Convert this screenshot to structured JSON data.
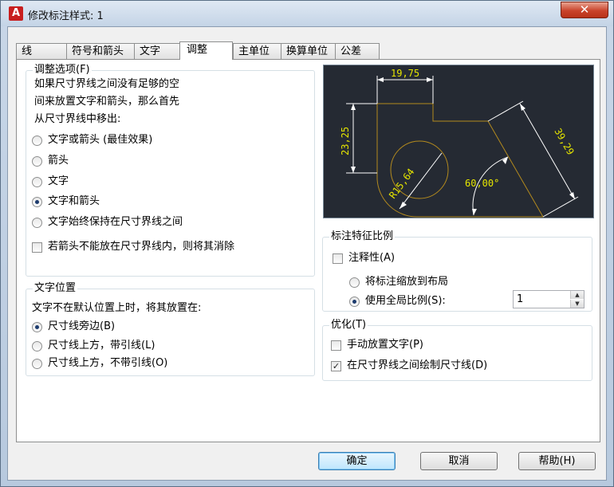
{
  "window": {
    "title": "修改标注样式: 1",
    "close_glyph": "✕",
    "app_icon_letter": "A"
  },
  "tabs": [
    {
      "label": "线"
    },
    {
      "label": "符号和箭头"
    },
    {
      "label": "文字"
    },
    {
      "label": "调整",
      "active": true
    },
    {
      "label": "主单位"
    },
    {
      "label": "换算单位"
    },
    {
      "label": "公差"
    }
  ],
  "fit_options": {
    "title": "调整选项(F)",
    "description": [
      "如果尺寸界线之间没有足够的空",
      "间来放置文字和箭头，那么首先",
      "从尺寸界线中移出:"
    ],
    "radios": [
      {
        "label": "文字或箭头 (最佳效果)",
        "selected": false
      },
      {
        "label": "箭头",
        "selected": false
      },
      {
        "label": "文字",
        "selected": false
      },
      {
        "label": "文字和箭头",
        "selected": true
      },
      {
        "label": "文字始终保持在尺寸界线之间",
        "selected": false
      }
    ],
    "suppress_checkbox": {
      "label": "若箭头不能放在尺寸界线内，则将其消除",
      "checked": false
    }
  },
  "text_placement": {
    "title": "文字位置",
    "description": "文字不在默认位置上时，将其放置在:",
    "radios": [
      {
        "label": "尺寸线旁边(B)",
        "selected": true
      },
      {
        "label": "尺寸线上方，带引线(L)",
        "selected": false
      },
      {
        "label": "尺寸线上方，不带引线(O)",
        "selected": false
      }
    ]
  },
  "preview": {
    "dim_top": "19,75",
    "dim_left": "23,25",
    "dim_right": "39,29",
    "dim_radius": "R15,64",
    "dim_angle": "60,00°",
    "background_color": "#252a33",
    "geometry_color": "#b38a1e",
    "dimension_color": "#ffffff",
    "text_color": "#e6e600"
  },
  "scale_for_features": {
    "title": "标注特征比例",
    "annotative": {
      "label": "注释性(A)",
      "checked": false
    },
    "radios": [
      {
        "label": "将标注缩放到布局",
        "selected": false
      },
      {
        "label": "使用全局比例(S):",
        "selected": true
      }
    ],
    "global_scale_value": "1",
    "spin_up": "▲",
    "spin_down": "▼"
  },
  "fine_tuning": {
    "title": "优化(T)",
    "manual_place": {
      "label": "手动放置文字(P)",
      "checked": false
    },
    "draw_dim_line": {
      "label": "在尺寸界线之间绘制尺寸线(D)",
      "checked": true
    },
    "check_glyph": "✓"
  },
  "buttons": {
    "ok": "确定",
    "cancel": "取消",
    "help": "帮助(H)"
  }
}
